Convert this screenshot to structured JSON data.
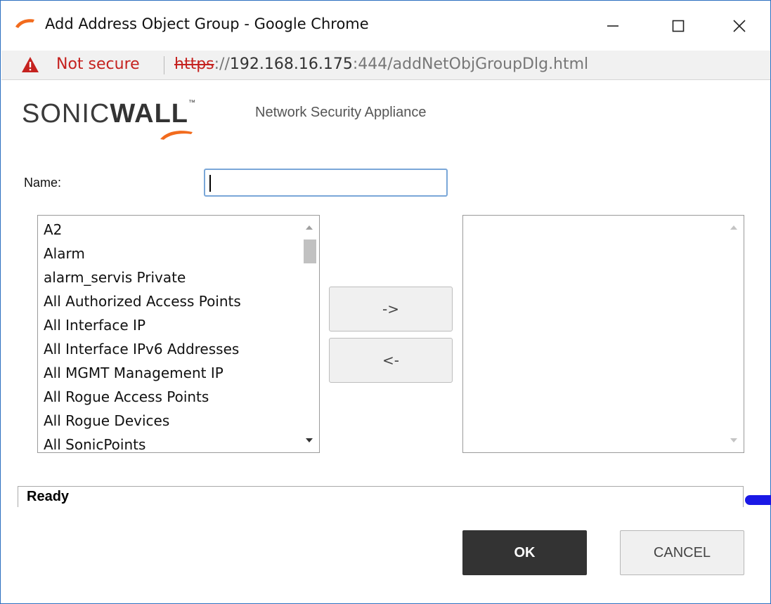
{
  "window": {
    "title": "Add Address Object Group - Google Chrome",
    "minimize_icon": "minimize-icon",
    "maximize_icon": "maximize-icon",
    "close_icon": "close-icon"
  },
  "addressbar": {
    "security_label": "Not secure",
    "url_scheme": "https",
    "url_sep": "://",
    "url_host": "192.168.16.175",
    "url_port": ":444",
    "url_path": "/addNetObjGroupDlg.html",
    "warning_icon": "warning-triangle-icon",
    "warning_color": "#c5221f"
  },
  "brand": {
    "logo_part1": "SONIC",
    "logo_part2": "WALL",
    "logo_tm": "™",
    "subtitle": "Network Security Appliance"
  },
  "form": {
    "name_label": "Name:",
    "name_value": "",
    "available_items": [
      "A2",
      "Alarm",
      "alarm_servis Private",
      "All Authorized Access Points",
      "All Interface IP",
      "All Interface IPv6 Addresses",
      "All MGMT Management IP",
      "All Rogue Access Points",
      "All Rogue Devices",
      "All SonicPoints"
    ],
    "selected_items": [],
    "add_button": "->",
    "remove_button": "<-"
  },
  "status": {
    "text": "Ready",
    "indicator_color": "#1a18e6"
  },
  "actions": {
    "ok": "OK",
    "cancel": "CANCEL",
    "ok_color": "#333333"
  }
}
